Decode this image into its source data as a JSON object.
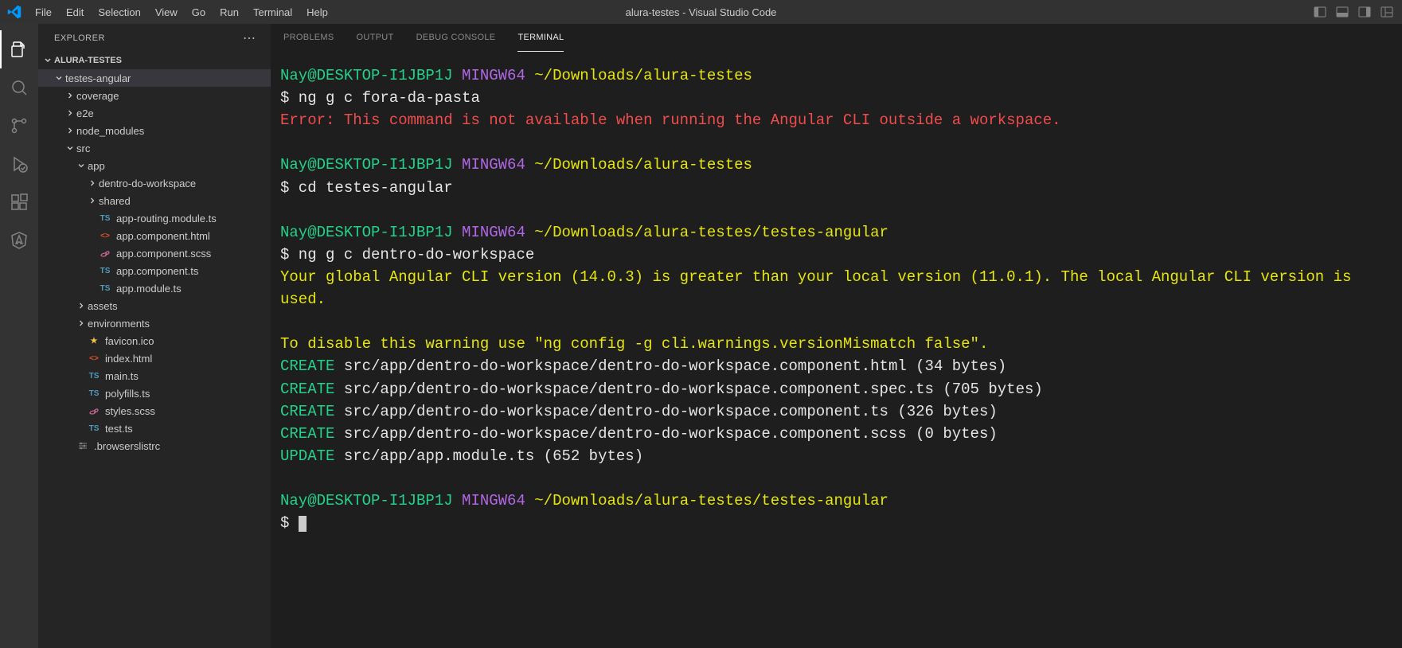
{
  "window": {
    "title": "alura-testes - Visual Studio Code"
  },
  "menu": [
    "File",
    "Edit",
    "Selection",
    "View",
    "Go",
    "Run",
    "Terminal",
    "Help"
  ],
  "sidebar": {
    "title": "EXPLORER",
    "section": "ALURA-TESTES",
    "tree": [
      {
        "indent": 1,
        "chev": "down",
        "icon": "",
        "label": "testes-angular",
        "selected": true
      },
      {
        "indent": 2,
        "chev": "right",
        "icon": "",
        "label": "coverage"
      },
      {
        "indent": 2,
        "chev": "right",
        "icon": "",
        "label": "e2e"
      },
      {
        "indent": 2,
        "chev": "right",
        "icon": "",
        "label": "node_modules"
      },
      {
        "indent": 2,
        "chev": "down",
        "icon": "",
        "label": "src"
      },
      {
        "indent": 3,
        "chev": "down",
        "icon": "",
        "label": "app"
      },
      {
        "indent": 4,
        "chev": "right",
        "icon": "",
        "label": "dentro-do-workspace"
      },
      {
        "indent": 4,
        "chev": "right",
        "icon": "",
        "label": "shared"
      },
      {
        "indent": 4,
        "chev": "",
        "icon": "ts",
        "label": "app-routing.module.ts"
      },
      {
        "indent": 4,
        "chev": "",
        "icon": "html",
        "label": "app.component.html"
      },
      {
        "indent": 4,
        "chev": "",
        "icon": "scss",
        "label": "app.component.scss"
      },
      {
        "indent": 4,
        "chev": "",
        "icon": "ts",
        "label": "app.component.ts"
      },
      {
        "indent": 4,
        "chev": "",
        "icon": "ts",
        "label": "app.module.ts"
      },
      {
        "indent": 3,
        "chev": "right",
        "icon": "",
        "label": "assets"
      },
      {
        "indent": 3,
        "chev": "right",
        "icon": "",
        "label": "environments"
      },
      {
        "indent": 3,
        "chev": "",
        "icon": "star",
        "label": "favicon.ico"
      },
      {
        "indent": 3,
        "chev": "",
        "icon": "html",
        "label": "index.html"
      },
      {
        "indent": 3,
        "chev": "",
        "icon": "ts",
        "label": "main.ts"
      },
      {
        "indent": 3,
        "chev": "",
        "icon": "ts",
        "label": "polyfills.ts"
      },
      {
        "indent": 3,
        "chev": "",
        "icon": "scss",
        "label": "styles.scss"
      },
      {
        "indent": 3,
        "chev": "",
        "icon": "ts",
        "label": "test.ts"
      },
      {
        "indent": 2,
        "chev": "",
        "icon": "cfg",
        "label": ".browserslistrc"
      }
    ]
  },
  "panel": {
    "tabs": [
      "PROBLEMS",
      "OUTPUT",
      "DEBUG CONSOLE",
      "TERMINAL"
    ],
    "active": 3
  },
  "terminal": {
    "lines": [
      {
        "segs": [
          {
            "c": "green",
            "t": "Nay@DESKTOP-I1JBP1J "
          },
          {
            "c": "purple",
            "t": "MINGW64 "
          },
          {
            "c": "yellow",
            "t": "~/Downloads/alura-testes"
          }
        ]
      },
      {
        "segs": [
          {
            "c": "white",
            "t": "$ ng g c fora-da-pasta"
          }
        ]
      },
      {
        "segs": [
          {
            "c": "red",
            "t": "Error: This command is not available when running the Angular CLI outside a workspace."
          }
        ]
      },
      {
        "segs": []
      },
      {
        "segs": [
          {
            "c": "green",
            "t": "Nay@DESKTOP-I1JBP1J "
          },
          {
            "c": "purple",
            "t": "MINGW64 "
          },
          {
            "c": "yellow",
            "t": "~/Downloads/alura-testes"
          }
        ]
      },
      {
        "segs": [
          {
            "c": "white",
            "t": "$ cd testes-angular"
          }
        ]
      },
      {
        "segs": []
      },
      {
        "segs": [
          {
            "c": "green",
            "t": "Nay@DESKTOP-I1JBP1J "
          },
          {
            "c": "purple",
            "t": "MINGW64 "
          },
          {
            "c": "yellow",
            "t": "~/Downloads/alura-testes/testes-angular"
          }
        ]
      },
      {
        "segs": [
          {
            "c": "white",
            "t": "$ ng g c dentro-do-workspace"
          }
        ]
      },
      {
        "segs": [
          {
            "c": "yellow",
            "t": "Your global Angular CLI version (14.0.3) is greater than your local version (11.0.1). The local Angular CLI version is used."
          }
        ]
      },
      {
        "segs": []
      },
      {
        "segs": [
          {
            "c": "yellow",
            "t": "To disable this warning use \"ng config -g cli.warnings.versionMismatch false\"."
          }
        ]
      },
      {
        "segs": [
          {
            "c": "green",
            "t": "CREATE "
          },
          {
            "c": "white",
            "t": "src/app/dentro-do-workspace/dentro-do-workspace.component.html (34 bytes)"
          }
        ]
      },
      {
        "segs": [
          {
            "c": "green",
            "t": "CREATE "
          },
          {
            "c": "white",
            "t": "src/app/dentro-do-workspace/dentro-do-workspace.component.spec.ts (705 bytes)"
          }
        ]
      },
      {
        "segs": [
          {
            "c": "green",
            "t": "CREATE "
          },
          {
            "c": "white",
            "t": "src/app/dentro-do-workspace/dentro-do-workspace.component.ts (326 bytes)"
          }
        ]
      },
      {
        "segs": [
          {
            "c": "green",
            "t": "CREATE "
          },
          {
            "c": "white",
            "t": "src/app/dentro-do-workspace/dentro-do-workspace.component.scss (0 bytes)"
          }
        ]
      },
      {
        "segs": [
          {
            "c": "green",
            "t": "UPDATE "
          },
          {
            "c": "white",
            "t": "src/app/app.module.ts (652 bytes)"
          }
        ]
      },
      {
        "segs": []
      },
      {
        "segs": [
          {
            "c": "green",
            "t": "Nay@DESKTOP-I1JBP1J "
          },
          {
            "c": "purple",
            "t": "MINGW64 "
          },
          {
            "c": "yellow",
            "t": "~/Downloads/alura-testes/testes-angular"
          }
        ]
      },
      {
        "segs": [
          {
            "c": "white",
            "t": "$ "
          }
        ],
        "cursor": true
      }
    ]
  }
}
